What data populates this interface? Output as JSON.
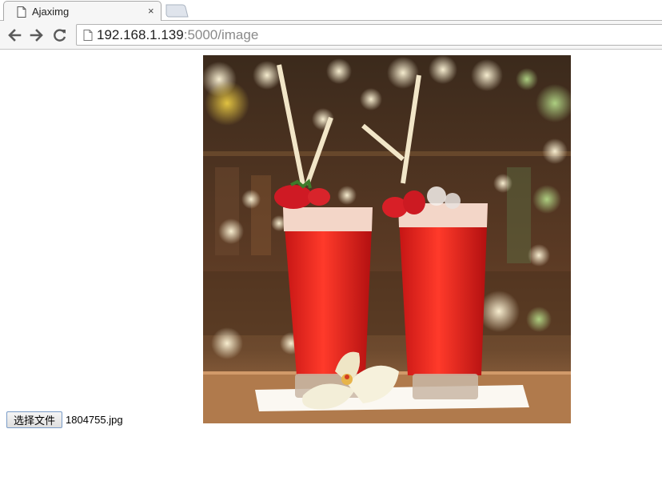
{
  "browser": {
    "tab": {
      "title": "Ajaximg",
      "close_glyph": "×"
    },
    "address": {
      "host": "192.168.1.139",
      "rest": ":5000/image"
    },
    "icons": [
      "page-icon",
      "back-icon",
      "forward-icon",
      "reload-icon",
      "close-icon",
      "new-tab-icon"
    ]
  },
  "upload": {
    "button_label": "选择文件",
    "file_name": "1804755.jpg"
  },
  "colors": {
    "drink": "#e02424",
    "background_bokeh": "#5a3a22",
    "accent_border": "#7a9cc8"
  }
}
